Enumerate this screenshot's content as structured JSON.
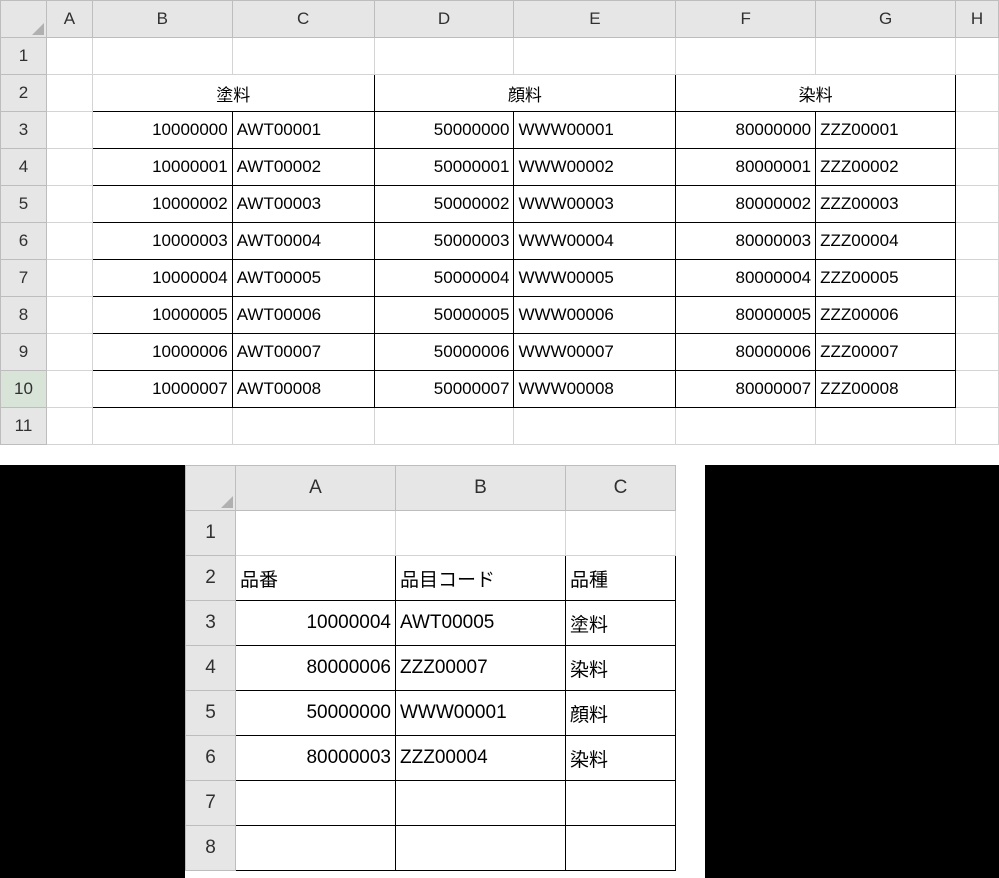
{
  "top": {
    "cols": [
      "A",
      "B",
      "C",
      "D",
      "E",
      "F",
      "G",
      "H"
    ],
    "rows": [
      "1",
      "2",
      "3",
      "4",
      "5",
      "6",
      "7",
      "8",
      "9",
      "10",
      "11"
    ],
    "headers": {
      "group1": "塗料",
      "group2": "顔料",
      "group3": "染料"
    },
    "data": [
      {
        "b": "10000000",
        "c": "AWT00001",
        "d": "50000000",
        "e": "WWW00001",
        "f": "80000000",
        "g": "ZZZ00001"
      },
      {
        "b": "10000001",
        "c": "AWT00002",
        "d": "50000001",
        "e": "WWW00002",
        "f": "80000001",
        "g": "ZZZ00002"
      },
      {
        "b": "10000002",
        "c": "AWT00003",
        "d": "50000002",
        "e": "WWW00003",
        "f": "80000002",
        "g": "ZZZ00003"
      },
      {
        "b": "10000003",
        "c": "AWT00004",
        "d": "50000003",
        "e": "WWW00004",
        "f": "80000003",
        "g": "ZZZ00004"
      },
      {
        "b": "10000004",
        "c": "AWT00005",
        "d": "50000004",
        "e": "WWW00005",
        "f": "80000004",
        "g": "ZZZ00005"
      },
      {
        "b": "10000005",
        "c": "AWT00006",
        "d": "50000005",
        "e": "WWW00006",
        "f": "80000005",
        "g": "ZZZ00006"
      },
      {
        "b": "10000006",
        "c": "AWT00007",
        "d": "50000006",
        "e": "WWW00007",
        "f": "80000006",
        "g": "ZZZ00007"
      },
      {
        "b": "10000007",
        "c": "AWT00008",
        "d": "50000007",
        "e": "WWW00008",
        "f": "80000007",
        "g": "ZZZ00008"
      }
    ]
  },
  "bottom": {
    "cols": [
      "A",
      "B",
      "C"
    ],
    "rows": [
      "1",
      "2",
      "3",
      "4",
      "5",
      "6",
      "7",
      "8"
    ],
    "headers": {
      "a": "品番",
      "b": "品目コード",
      "c": "品種"
    },
    "data": [
      {
        "a": "10000004",
        "b": "AWT00005",
        "c": "塗料"
      },
      {
        "a": "80000006",
        "b": "ZZZ00007",
        "c": "染料"
      },
      {
        "a": "50000000",
        "b": "WWW00001",
        "c": "顔料"
      },
      {
        "a": "80000003",
        "b": "ZZZ00004",
        "c": "染料"
      }
    ]
  }
}
